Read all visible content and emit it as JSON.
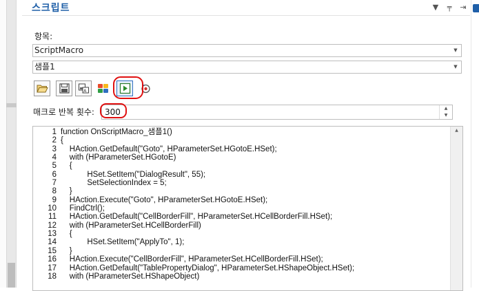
{
  "panel": {
    "title": "스크립트",
    "controls": [
      "▾",
      "📌",
      "⇥"
    ]
  },
  "form": {
    "item_label": "항목:",
    "script_combo": "ScriptMacro",
    "sample_combo": "샘플1",
    "repeat_label": "매크로 반복 횟수:",
    "repeat_value": "300"
  },
  "toolbar": {
    "icons": [
      "open-folder-icon",
      "save-icon",
      "save-as-icon",
      "addin-icon",
      "run-icon",
      "record-icon"
    ]
  },
  "highlight_color": "#e01010",
  "code_lines": [
    {
      "n": "1",
      "t": "function OnScriptMacro_샘플1()"
    },
    {
      "n": "2",
      "t": "{"
    },
    {
      "n": "3",
      "t": "    HAction.GetDefault(\"Goto\", HParameterSet.HGotoE.HSet);"
    },
    {
      "n": "4",
      "t": "    with (HParameterSet.HGotoE)"
    },
    {
      "n": "5",
      "t": "    {"
    },
    {
      "n": "6",
      "t": "            HSet.SetItem(\"DialogResult\", 55);"
    },
    {
      "n": "7",
      "t": "            SetSelectionIndex = 5;"
    },
    {
      "n": "8",
      "t": "    }"
    },
    {
      "n": "9",
      "t": "    HAction.Execute(\"Goto\", HParameterSet.HGotoE.HSet);"
    },
    {
      "n": "10",
      "t": "    FindCtrl();"
    },
    {
      "n": "11",
      "t": "    HAction.GetDefault(\"CellBorderFill\", HParameterSet.HCellBorderFill.HSet);"
    },
    {
      "n": "12",
      "t": "    with (HParameterSet.HCellBorderFill)"
    },
    {
      "n": "13",
      "t": "    {"
    },
    {
      "n": "14",
      "t": "            HSet.SetItem(\"ApplyTo\", 1);"
    },
    {
      "n": "15",
      "t": "    }"
    },
    {
      "n": "16",
      "t": "    HAction.Execute(\"CellBorderFill\", HParameterSet.HCellBorderFill.HSet);"
    },
    {
      "n": "17",
      "t": "    HAction.GetDefault(\"TablePropertyDialog\", HParameterSet.HShapeObject.HSet);"
    },
    {
      "n": "18",
      "t": "    with (HParameterSet.HShapeObject)"
    }
  ]
}
